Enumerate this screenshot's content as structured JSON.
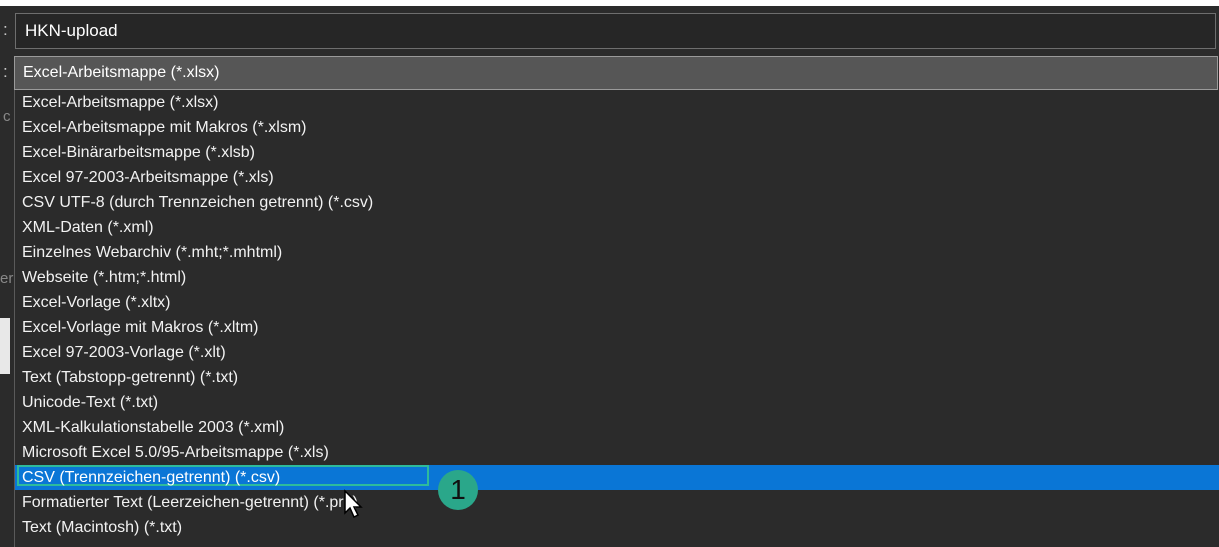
{
  "side_labels": {
    "filename_colon": ":",
    "filetype_colon": ":",
    "stub_c": "c",
    "stub_er": "er"
  },
  "filename": {
    "value": "HKN-upload"
  },
  "filetype": {
    "selected_value": "Excel-Arbeitsmappe (*.xlsx)",
    "options": [
      "Excel-Arbeitsmappe (*.xlsx)",
      "Excel-Arbeitsmappe mit Makros (*.xlsm)",
      "Excel-Binärarbeitsmappe (*.xlsb)",
      "Excel 97-2003-Arbeitsmappe (*.xls)",
      "CSV UTF-8 (durch Trennzeichen getrennt) (*.csv)",
      "XML-Daten (*.xml)",
      "Einzelnes Webarchiv (*.mht;*.mhtml)",
      "Webseite (*.htm;*.html)",
      "Excel-Vorlage (*.xltx)",
      "Excel-Vorlage mit Makros (*.xltm)",
      "Excel 97-2003-Vorlage (*.xlt)",
      "Text (Tabstopp-getrennt) (*.txt)",
      "Unicode-Text (*.txt)",
      "XML-Kalkulationstabelle 2003 (*.xml)",
      "Microsoft Excel 5.0/95-Arbeitsmappe (*.xls)",
      "CSV (Trennzeichen-getrennt) (*.csv)",
      "Formatierter Text (Leerzeichen-getrennt) (*.prn)",
      "Text (Macintosh) (*.txt)"
    ],
    "highlighted_index": 15
  },
  "callout": {
    "number": "1",
    "color": "#2aa78a"
  },
  "colors": {
    "highlight": "#0a76d6",
    "outline": "#2ebb9c",
    "background": "#2b2b2b"
  },
  "icons": {
    "cursor": "mouse-pointer-icon"
  }
}
